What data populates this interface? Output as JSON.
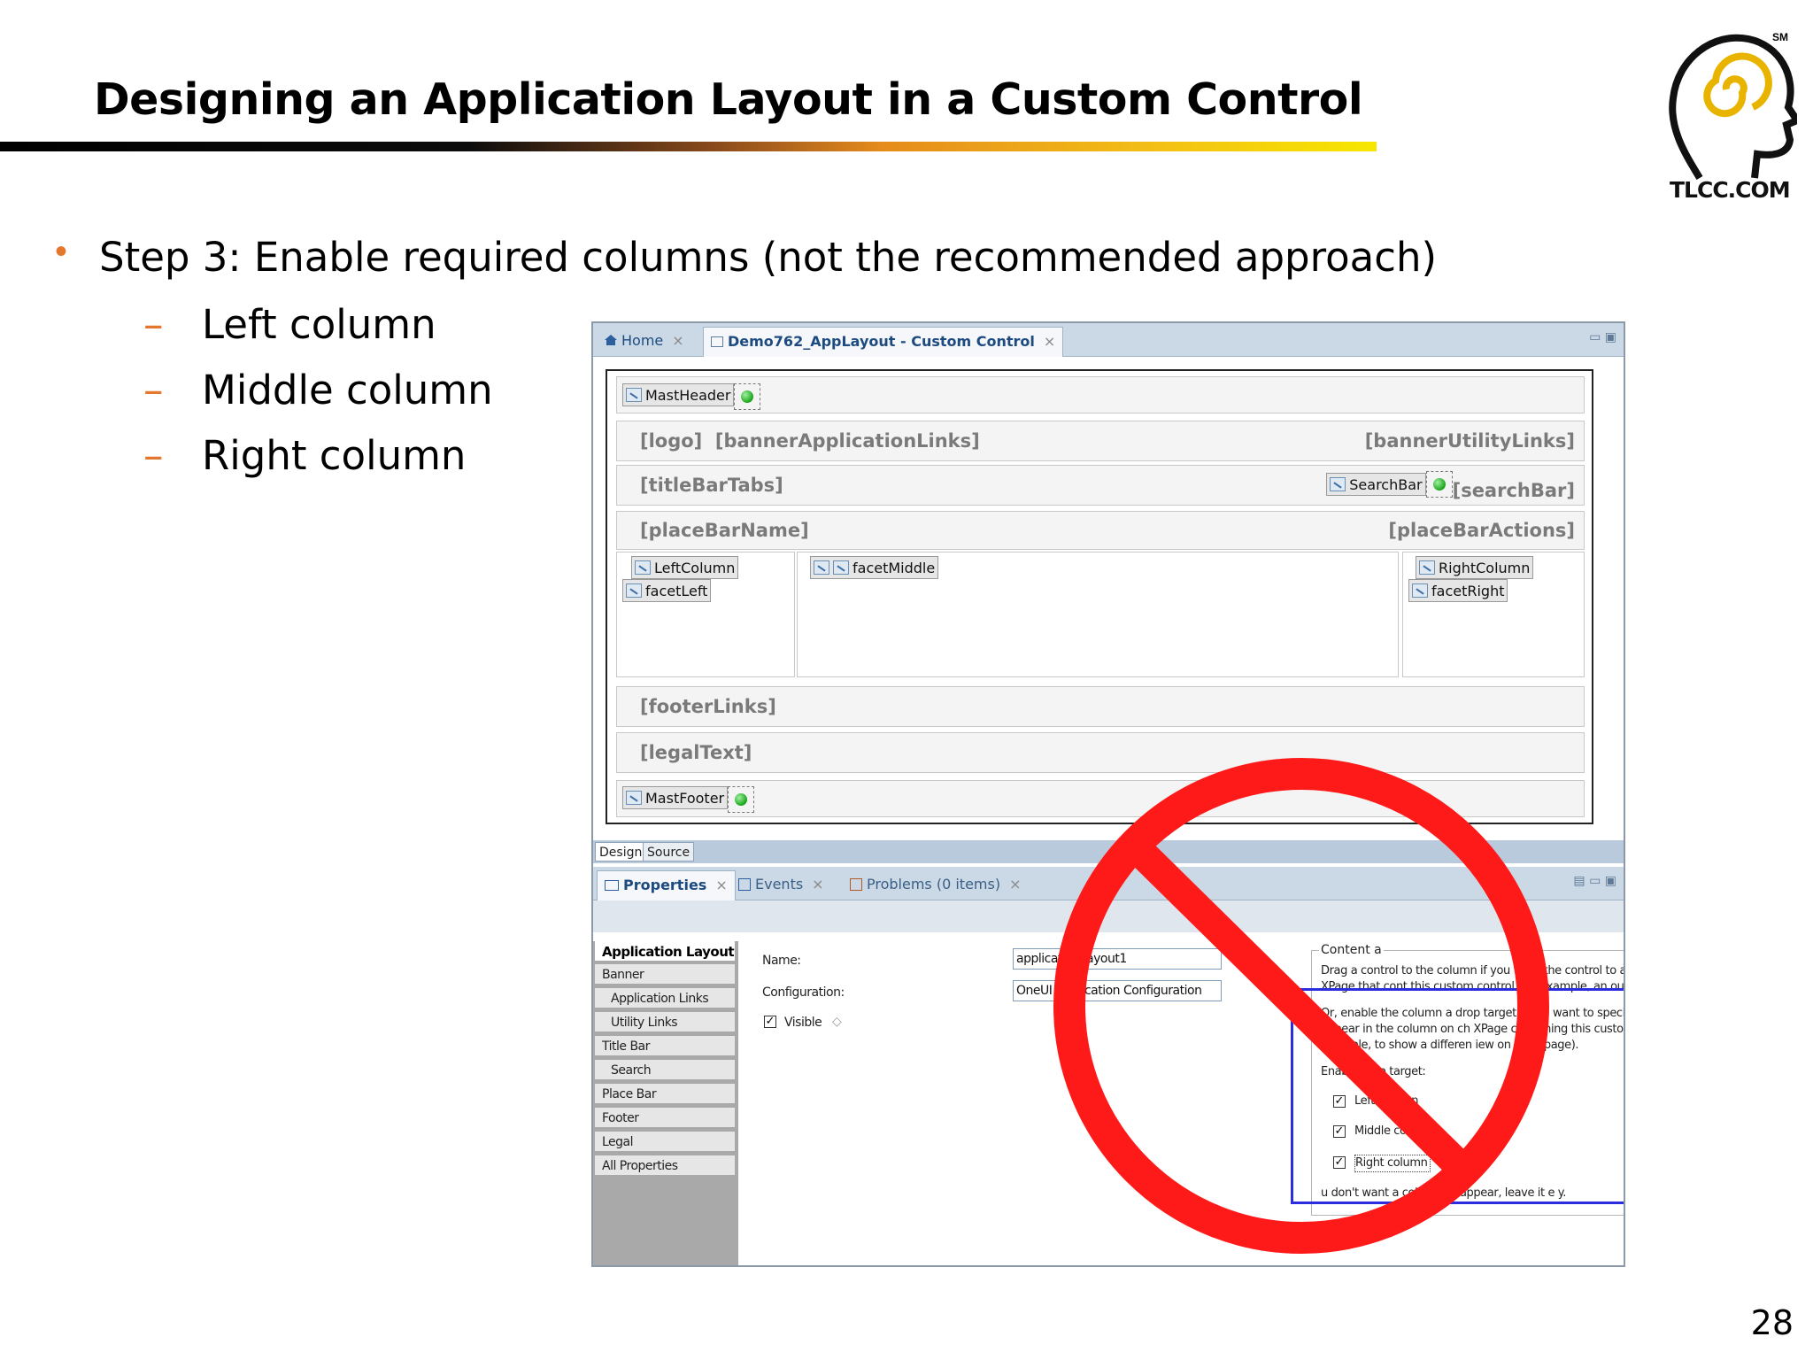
{
  "slide": {
    "title": "Designing an Application Layout in a Custom Control",
    "logo_text": "TLCC.COM",
    "logo_mark": "SM",
    "page_number": "28",
    "bullet": "Step 3:  Enable required columns (not the recommended approach)",
    "sub_bullets": [
      "Left column",
      "Middle column",
      "Right column"
    ],
    "dash": "–"
  },
  "editor": {
    "tabs": [
      {
        "label": "Home",
        "close": "×"
      },
      {
        "label": "Demo762_AppLayout - Custom Control",
        "close": "×"
      }
    ],
    "design": {
      "mastheader": "MastHeader",
      "logo": "[logo]",
      "banner_app_links": "[bannerApplicationLinks]",
      "banner_utility_links": "[bannerUtilityLinks]",
      "title_bar_tabs": "[titleBarTabs]",
      "search_bar_control": "SearchBar",
      "search_bar": "[searchBar]",
      "place_bar_name": "[placeBarName]",
      "place_bar_actions": "[placeBarActions]",
      "left_column": "LeftColumn",
      "facet_left": "facetLeft",
      "facet_middle": "facetMiddle",
      "right_column": "RightColumn",
      "facet_right": "facetRight",
      "footer_links": "[footerLinks]",
      "legal_text": "[legalText]",
      "mastfooter": "MastFooter"
    },
    "mode_tabs": [
      "Design",
      "Source"
    ]
  },
  "properties": {
    "tabs": [
      {
        "label": "Properties",
        "close": "×"
      },
      {
        "label": "Events",
        "close": "×"
      },
      {
        "label": "Problems (0 items)",
        "close": "×"
      }
    ],
    "nav": [
      "Application Layout",
      "Banner",
      "Application Links",
      "Utility Links",
      "Title Bar",
      "Search",
      "Place Bar",
      "Footer",
      "Legal",
      "All Properties"
    ],
    "name_label": "Name:",
    "name_value": "applicationLayout1",
    "config_label": "Configuration:",
    "config_value": "OneUI Application Configuration",
    "visible_label": "Visible",
    "visible_checked": true,
    "content_area": {
      "title": "Content a",
      "para1_line1": "Drag a control  to the column if you want the control to appear on  each",
      "para1_line2": "XPage that cont    this custom control (for example, an outline).",
      "para2_line1": "Or, enable the column   a drop target if you want to specify what   ould",
      "para2_line2": "appear in the column on   ch XPage containing this custom contr   (for",
      "para2_line3": "example, to show a differen   iew on each page).",
      "enable_label": "Enable drop target:",
      "checkboxes": [
        {
          "label": "Left column",
          "checked": true
        },
        {
          "label": "Middle column",
          "checked": true
        },
        {
          "label": "Right column",
          "checked": true
        }
      ],
      "footer_note": "  u don't want a column to appear, leave it e   y."
    }
  },
  "colors": {
    "bullet_accent": "#e4772e",
    "prohibition_red": "#ff1a1a",
    "highlight_blue": "#2d2de0"
  },
  "icons": [
    "home-icon",
    "custom-control-icon",
    "properties-icon",
    "events-icon",
    "problems-icon",
    "green-status-icon",
    "no-entry-icon"
  ]
}
